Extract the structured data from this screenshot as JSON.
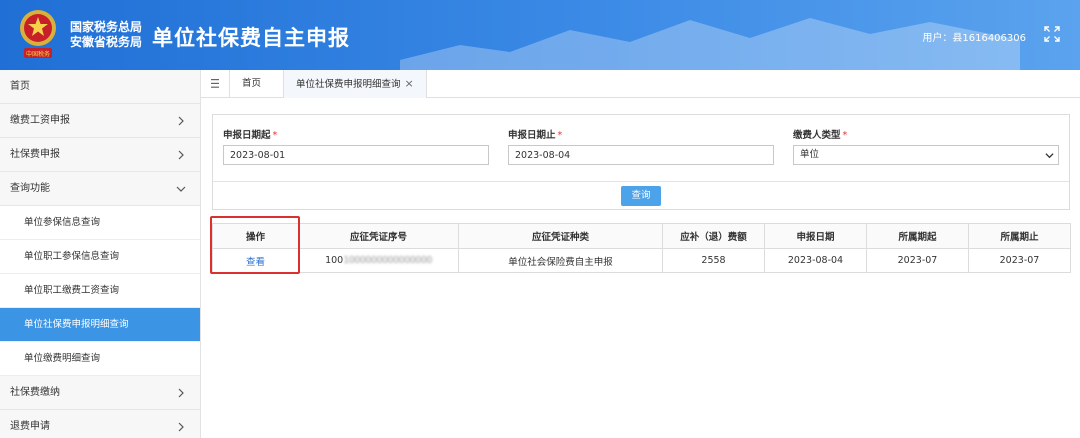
{
  "header": {
    "org_line1": "国家税务总局",
    "org_line2": "安徽省税务局",
    "title": "单位社保费自主申报",
    "user_label": "用户：",
    "user_value": "县1616406306",
    "emblem_icon": "national-emblem-icon",
    "fullscreen_icon": "fullscreen-icon"
  },
  "sidebar": {
    "items": [
      {
        "label": "首页"
      },
      {
        "label": "缴费工资申报"
      },
      {
        "label": "社保费申报"
      },
      {
        "label": "查询功能"
      },
      {
        "label": "社保费缴纳"
      },
      {
        "label": "退费申请"
      }
    ],
    "subitems": [
      {
        "label": "单位参保信息查询"
      },
      {
        "label": "单位职工参保信息查询"
      },
      {
        "label": "单位职工缴费工资查询"
      },
      {
        "label": "单位社保费申报明细查询"
      },
      {
        "label": "单位缴费明细查询"
      }
    ],
    "active_color": "#3b94e4"
  },
  "tabs": {
    "home": "首页",
    "active": "单位社保费申报明细查询",
    "close_icon": "close-icon",
    "menu_icon": "menu-icon"
  },
  "form": {
    "start_label": "申报日期起",
    "start_value": "2023-08-01",
    "end_label": "申报日期止",
    "end_value": "2023-08-04",
    "type_label": "缴费人类型",
    "type_value": "单位",
    "required_mark": "*",
    "query_button": "查询"
  },
  "table": {
    "headers": [
      "操作",
      "应征凭证序号",
      "应征凭证种类",
      "应补（退）费额",
      "申报日期",
      "所属期起",
      "所属期止"
    ],
    "rows": [
      {
        "action": "查看",
        "serial_visible": "100",
        "serial_blurred": "1000000000000000",
        "type": "单位社会保险费自主申报",
        "amount": "2558",
        "date": "2023-08-04",
        "period_start": "2023-07",
        "period_end": "2023-07"
      }
    ]
  },
  "colors": {
    "header_blue": "#1f6fd6",
    "button_blue": "#4da3ea",
    "link_blue": "#2a6fd0",
    "highlight_red": "#d93030"
  }
}
